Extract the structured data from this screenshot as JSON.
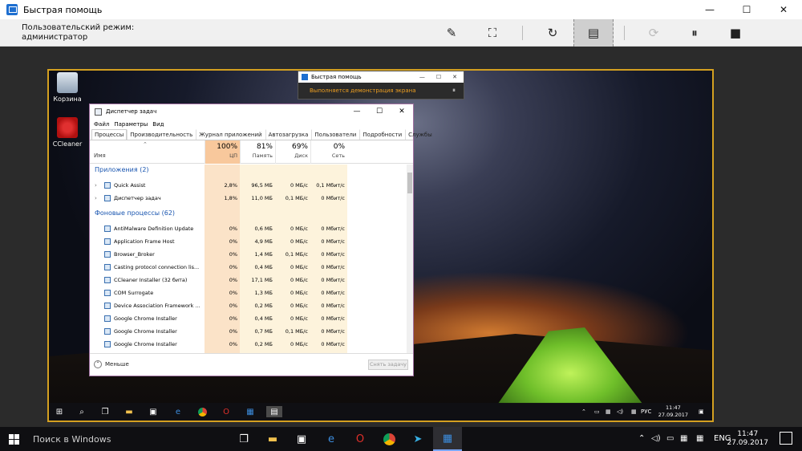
{
  "window": {
    "title": "Быстрая помощь",
    "controls": {
      "minimize": "—",
      "maximize": "☐",
      "close": "✕"
    }
  },
  "toolbar": {
    "mode_line1": "Пользовательский режим:",
    "mode_line2": "администратор",
    "buttons": {
      "annotate": "✎",
      "fit_screen": "⛶",
      "restart": "↻",
      "task_manager": "▤",
      "reconnect": "⟳",
      "pause": "⏸",
      "stop": "■"
    }
  },
  "remote": {
    "desktop_icons": [
      {
        "label": "Корзина"
      },
      {
        "label": "CCleaner"
      }
    ],
    "mini_qa": {
      "title": "Быстрая помощь",
      "status": "Выполняется демонстрация экрана",
      "controls": {
        "minimize": "—",
        "maximize": "☐",
        "close": "✕"
      },
      "pause": "⏸"
    },
    "task_manager": {
      "title": "Диспетчер задач",
      "controls": {
        "minimize": "—",
        "maximize": "☐",
        "close": "✕"
      },
      "menu": [
        "Файл",
        "Параметры",
        "Вид"
      ],
      "tabs": [
        "Процессы",
        "Производительность",
        "Журнал приложений",
        "Автозагрузка",
        "Пользователи",
        "Подробности",
        "Службы"
      ],
      "columns": {
        "name": "Имя",
        "cpu": {
          "pct": "100%",
          "label": "ЦП"
        },
        "mem": {
          "pct": "81%",
          "label": "Память"
        },
        "disk": {
          "pct": "69%",
          "label": "Диск"
        },
        "net": {
          "pct": "0%",
          "label": "Сеть"
        }
      },
      "groups": {
        "apps": "Приложения (2)",
        "background": "Фоновые процессы (62)"
      },
      "apps": [
        {
          "name": "Quick Assist",
          "cpu": "2,8%",
          "mem": "96,5 МБ",
          "disk": "0 МБ/с",
          "net": "0,1 Мбит/с"
        },
        {
          "name": "Диспетчер задач",
          "cpu": "1,8%",
          "mem": "11,0 МБ",
          "disk": "0,1 МБ/с",
          "net": "0 Мбит/с"
        }
      ],
      "background": [
        {
          "name": "AntiMalware Definition Update",
          "cpu": "0%",
          "mem": "0,6 МБ",
          "disk": "0 МБ/с",
          "net": "0 Мбит/с"
        },
        {
          "name": "Application Frame Host",
          "cpu": "0%",
          "mem": "4,9 МБ",
          "disk": "0 МБ/с",
          "net": "0 Мбит/с"
        },
        {
          "name": "Browser_Broker",
          "cpu": "0%",
          "mem": "1,4 МБ",
          "disk": "0,1 МБ/с",
          "net": "0 Мбит/с"
        },
        {
          "name": "Casting protocol connection lis...",
          "cpu": "0%",
          "mem": "0,4 МБ",
          "disk": "0 МБ/с",
          "net": "0 Мбит/с"
        },
        {
          "name": "CCleaner Installer (32 бита)",
          "cpu": "0%",
          "mem": "17,1 МБ",
          "disk": "0 МБ/с",
          "net": "0 Мбит/с"
        },
        {
          "name": "COM Surrogate",
          "cpu": "0%",
          "mem": "1,3 МБ",
          "disk": "0 МБ/с",
          "net": "0 Мбит/с"
        },
        {
          "name": "Device Association Framework ...",
          "cpu": "0%",
          "mem": "0,2 МБ",
          "disk": "0 МБ/с",
          "net": "0 Мбит/с"
        },
        {
          "name": "Google Chrome Installer",
          "cpu": "0%",
          "mem": "0,4 МБ",
          "disk": "0 МБ/с",
          "net": "0 Мбит/с"
        },
        {
          "name": "Google Chrome Installer",
          "cpu": "0%",
          "mem": "0,7 МБ",
          "disk": "0,1 МБ/с",
          "net": "0 Мбит/с"
        },
        {
          "name": "Google Chrome Installer",
          "cpu": "0%",
          "mem": "0,2 МБ",
          "disk": "0 МБ/с",
          "net": "0 Мбит/с"
        }
      ],
      "footer": {
        "less": "Меньше",
        "end_task": "Снять задачу"
      }
    },
    "taskbar": {
      "lang": "РУС",
      "time": "11:47",
      "date": "27.09.2017"
    }
  },
  "host_taskbar": {
    "search_placeholder": "Поиск в Windows",
    "lang": "ENG",
    "time": "11:47",
    "date": "27.09.2017"
  },
  "colors": {
    "accent_border": "#d4a020",
    "cpu_highlight": "#f8c89c",
    "group_text": "#1a56b0",
    "status_text": "#f0a020"
  }
}
